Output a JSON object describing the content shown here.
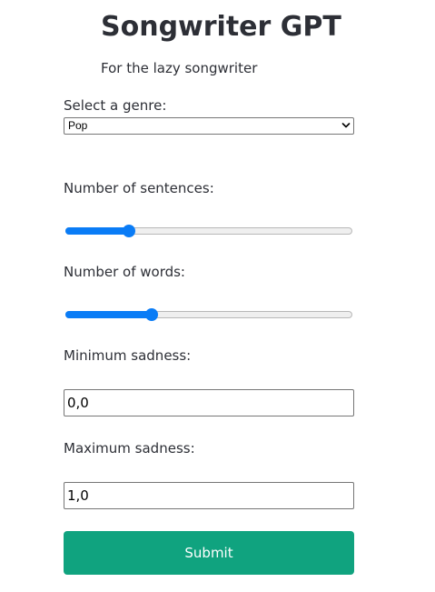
{
  "header": {
    "title": "Songwriter GPT",
    "subtitle": "For the lazy songwriter"
  },
  "form": {
    "genre": {
      "label": "Select a genre:",
      "selected": "Pop"
    },
    "sentences": {
      "label": "Number of sentences:",
      "fraction": 0.22
    },
    "words": {
      "label": "Number of words:",
      "fraction": 0.3
    },
    "min_sadness": {
      "label": "Minimum sadness:",
      "value": "0,0"
    },
    "max_sadness": {
      "label": "Maximum sadness:",
      "value": "1,0"
    },
    "submit_label": "Submit"
  },
  "icons": {
    "select_chevron": "chevron-down-icon"
  },
  "colors": {
    "accent_button": "#10a37f",
    "slider_active": "#0a7cf6"
  }
}
